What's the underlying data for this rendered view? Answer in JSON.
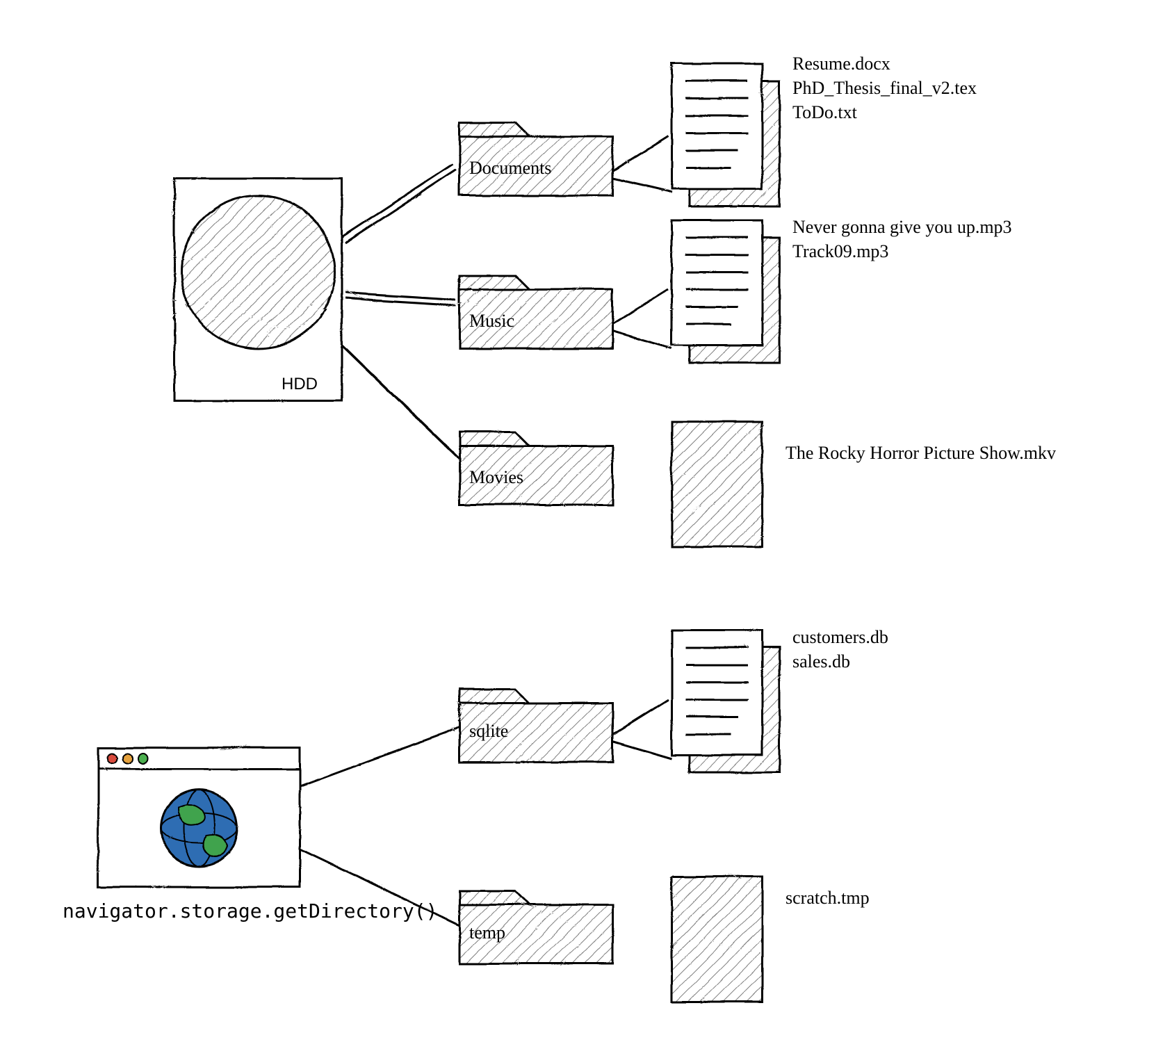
{
  "hdd": {
    "label": "HDD"
  },
  "browser_api": {
    "label": "navigator.storage.getDirectory()"
  },
  "hdd_tree": {
    "folders": [
      {
        "name": "Documents",
        "files": [
          "Resume.docx",
          "PhD_Thesis_final_v2.tex",
          "ToDo.txt"
        ]
      },
      {
        "name": "Music",
        "files": [
          "Never gonna give you up.mp3",
          "Track09.mp3"
        ]
      },
      {
        "name": "Movies",
        "files": [
          "The Rocky Horror Picture Show.mkv"
        ]
      }
    ]
  },
  "browser_tree": {
    "folders": [
      {
        "name": "sqlite",
        "files": [
          "customers.db",
          "sales.db"
        ]
      },
      {
        "name": "temp",
        "files": [
          "scratch.tmp"
        ]
      }
    ]
  }
}
